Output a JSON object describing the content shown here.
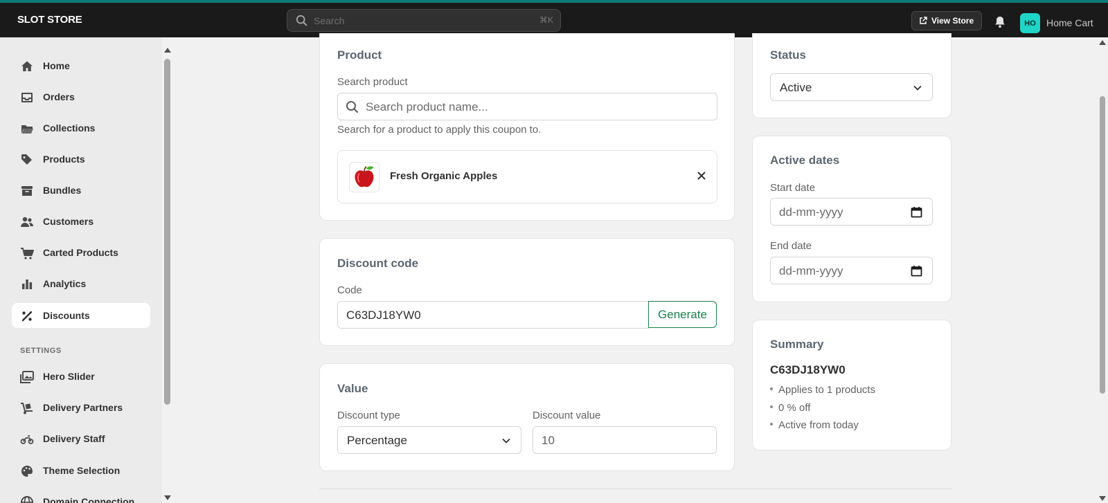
{
  "topbar": {
    "brand": "SLOT STORE",
    "search_placeholder": "Search",
    "search_shortcut": "⌘K",
    "view_store_label": "View Store",
    "avatar_initials": "HO",
    "store_name": "Home Cart"
  },
  "sidebar": {
    "items": [
      {
        "label": "Home",
        "icon": "home-icon"
      },
      {
        "label": "Orders",
        "icon": "inbox-icon"
      },
      {
        "label": "Collections",
        "icon": "folder-icon"
      },
      {
        "label": "Products",
        "icon": "tag-icon"
      },
      {
        "label": "Bundles",
        "icon": "archive-icon"
      },
      {
        "label": "Customers",
        "icon": "people-icon"
      },
      {
        "label": "Carted Products",
        "icon": "cart-icon"
      },
      {
        "label": "Analytics",
        "icon": "bar-chart-icon"
      },
      {
        "label": "Discounts",
        "icon": "percent-icon",
        "active": true
      }
    ],
    "settings_heading": "SETTINGS",
    "settings_items": [
      {
        "label": "Hero Slider",
        "icon": "images-icon"
      },
      {
        "label": "Delivery Partners",
        "icon": "dolly-icon"
      },
      {
        "label": "Delivery Staff",
        "icon": "motorcycle-icon"
      },
      {
        "label": "Theme Selection",
        "icon": "palette-icon"
      },
      {
        "label": "Domain Connection",
        "icon": "globe-icon"
      }
    ]
  },
  "product_card": {
    "title": "Product",
    "search_label": "Search product",
    "search_placeholder": "Search product name...",
    "helper": "Search for a product to apply this coupon to.",
    "selected_product": "Fresh Organic Apples"
  },
  "discount_code_card": {
    "title": "Discount code",
    "code_label": "Code",
    "code_value": "C63DJ18YW0",
    "generate_label": "Generate"
  },
  "value_card": {
    "title": "Value",
    "type_label": "Discount type",
    "type_value": "Percentage",
    "value_label": "Discount value",
    "value_value": "10"
  },
  "status_card": {
    "title": "Status",
    "value": "Active"
  },
  "dates_card": {
    "title": "Active dates",
    "start_label": "Start date",
    "start_placeholder": "dd-mm-yyyy",
    "end_label": "End date",
    "end_placeholder": "dd-mm-yyyy"
  },
  "summary_card": {
    "title": "Summary",
    "code": "C63DJ18YW0",
    "lines": [
      "Applies to 1 products",
      "0 % off",
      "Active from today"
    ]
  },
  "colors": {
    "topbar_bg": "#1a1a1a",
    "accent_teal": "#1fd5c8",
    "generate_green": "#1a7f4b"
  }
}
